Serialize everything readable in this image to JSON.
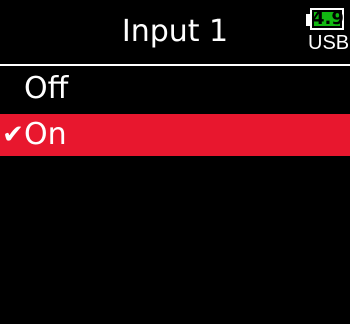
{
  "header": {
    "title": "Input 1"
  },
  "battery": {
    "value": "4.9",
    "source": "USB",
    "level_percent": 100,
    "fill_color": "#12b812"
  },
  "menu": {
    "items": [
      {
        "label": "Off",
        "checked": false,
        "selected": false
      },
      {
        "label": "On",
        "checked": true,
        "selected": true,
        "check_mark": "✔"
      }
    ],
    "selected_color": "#e8172e"
  }
}
